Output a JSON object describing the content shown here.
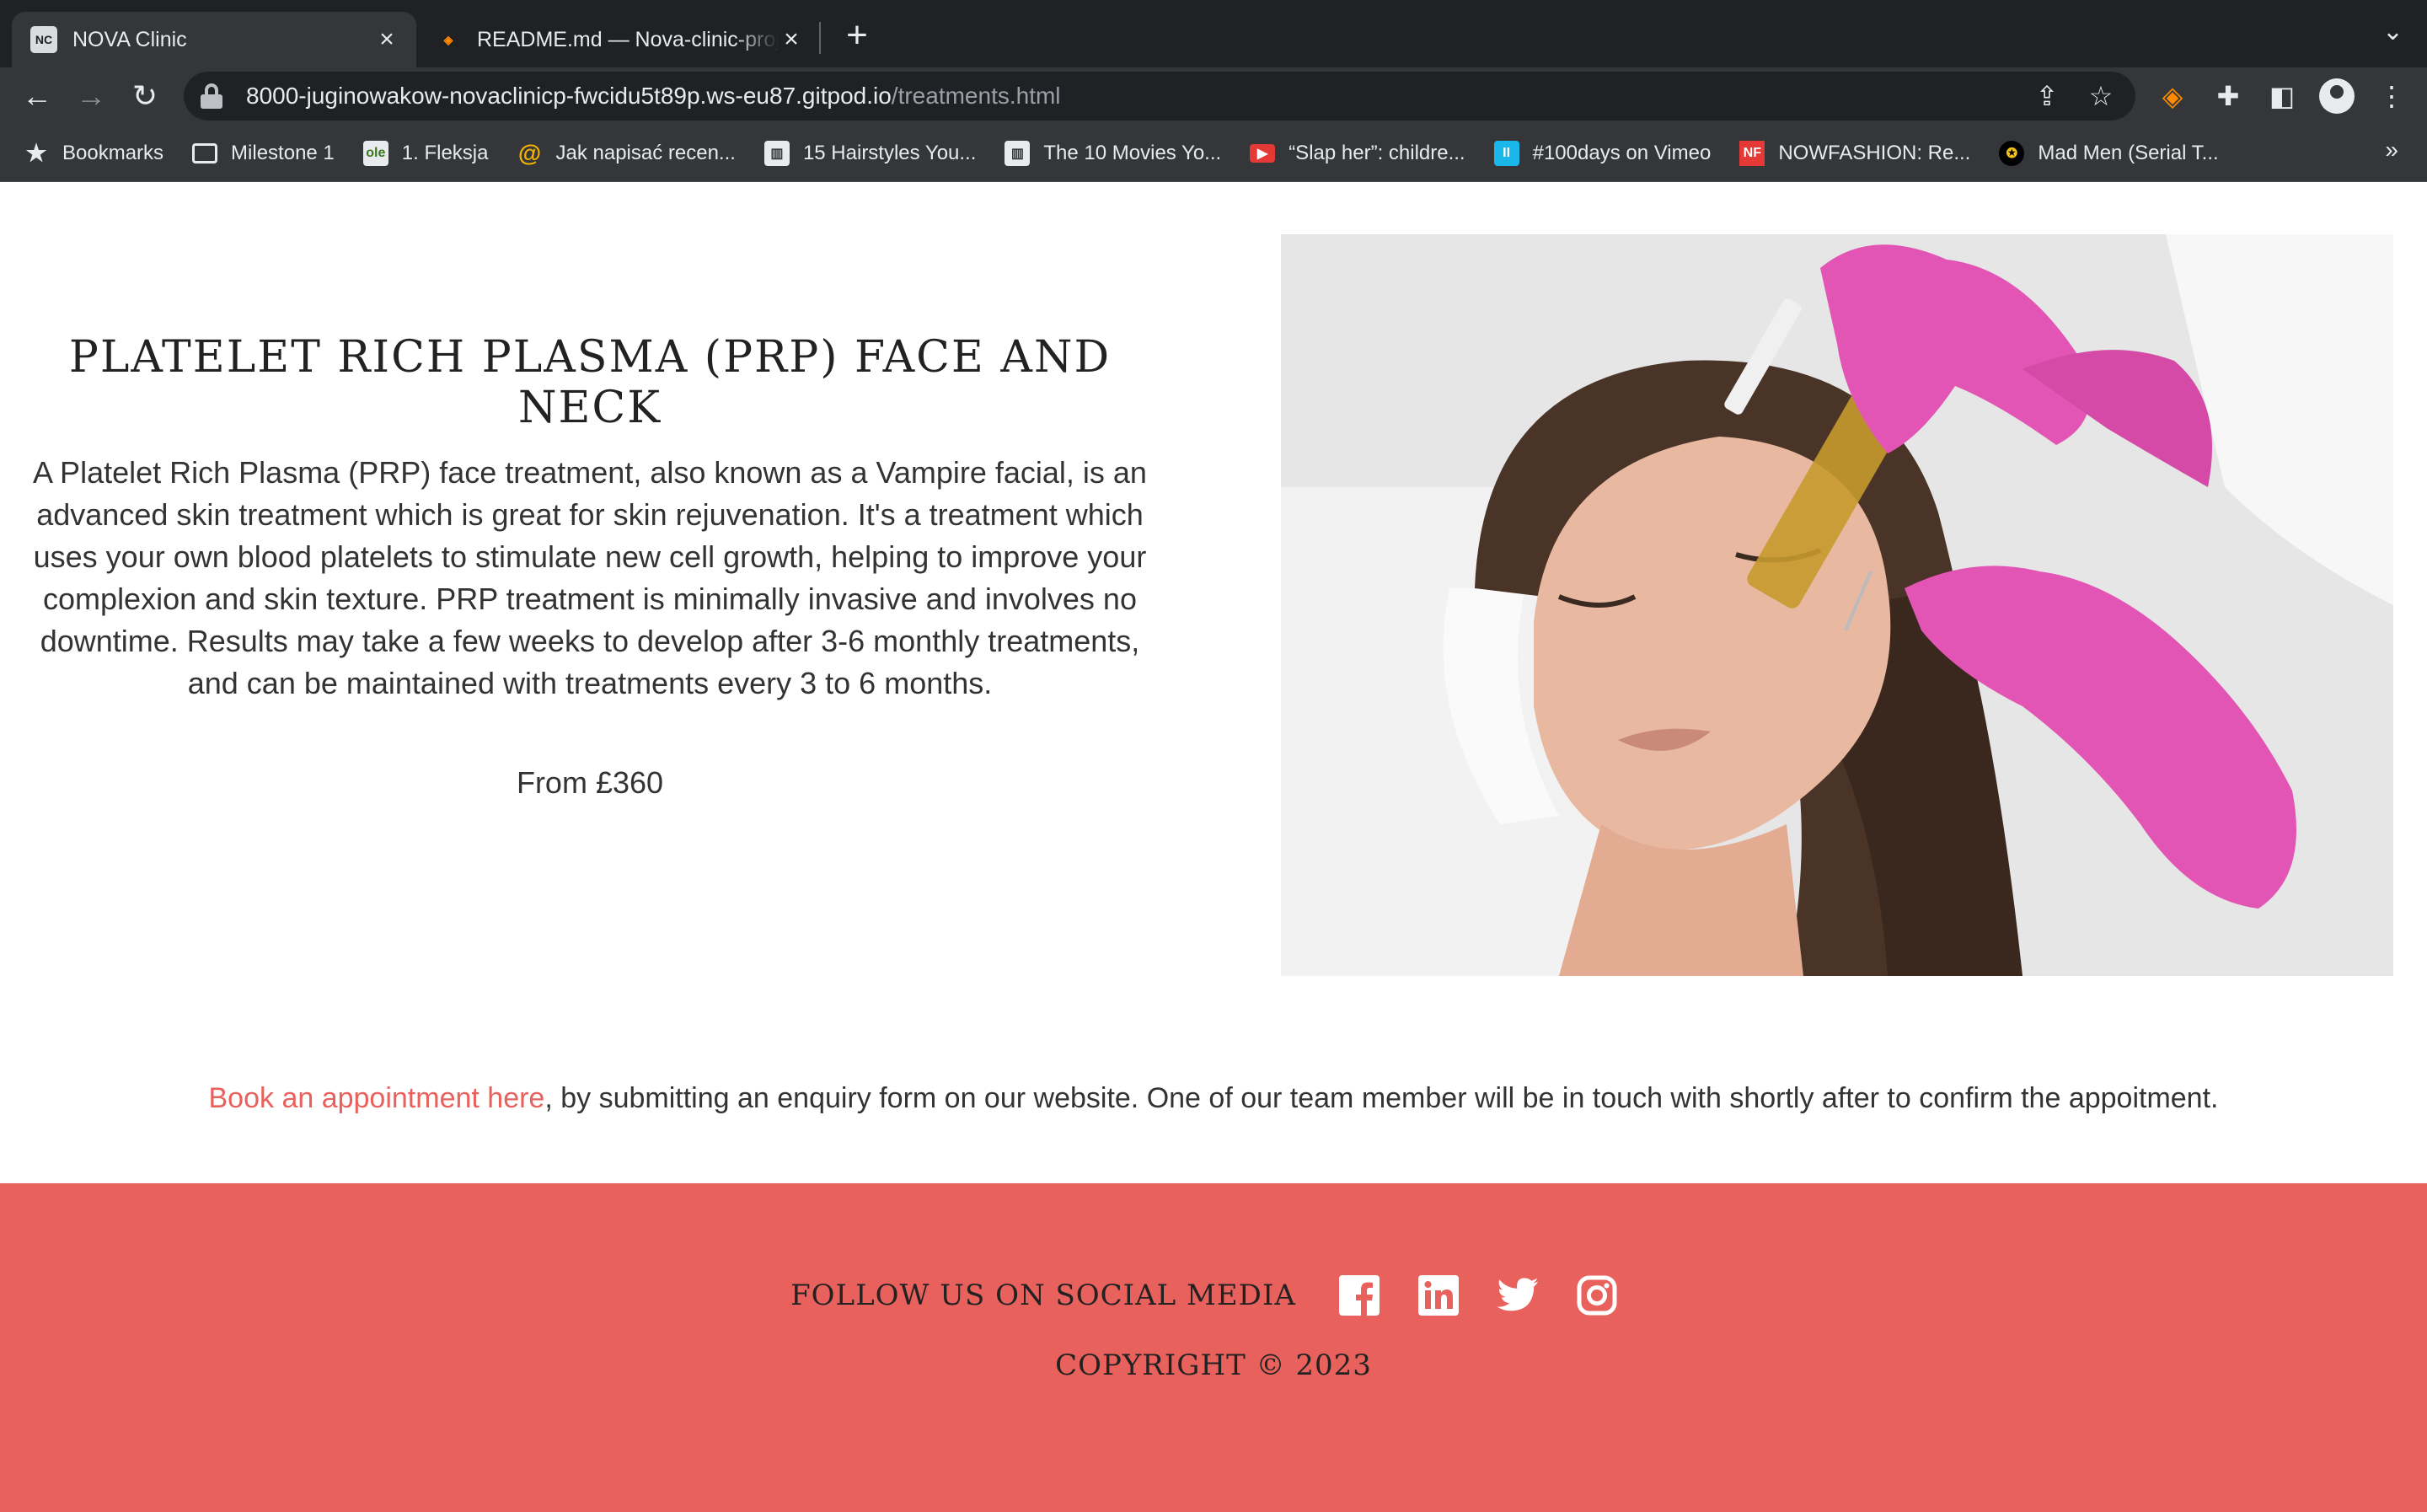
{
  "browser": {
    "tabs": [
      {
        "title": "NOVA Clinic",
        "icon": "nova-favicon",
        "active": true
      },
      {
        "title": "README.md — Nova-clinic-project",
        "icon": "gitpod-favicon",
        "active": false
      }
    ],
    "url": {
      "host": "8000-juginowakow-novaclinicp-fwcidu5t89p.ws-eu87.gitpod.io",
      "path": "/treatments.html"
    },
    "bookmarks": [
      {
        "label": "Bookmarks",
        "icon": "star-icon"
      },
      {
        "label": "Milestone 1",
        "icon": "folder-icon"
      },
      {
        "label": "1. Fleksja",
        "icon": "ole-favicon"
      },
      {
        "label": "Jak napisać recen...",
        "icon": "spiral-favicon"
      },
      {
        "label": "15 Hairstyles You...",
        "icon": "page-favicon"
      },
      {
        "label": "The 10 Movies Yo...",
        "icon": "page-favicon"
      },
      {
        "label": "“Slap her”: childre...",
        "icon": "youtube-favicon"
      },
      {
        "label": "#100days on Vimeo",
        "icon": "vimeo-favicon"
      },
      {
        "label": "NOWFASHION: Re...",
        "icon": "nf-favicon"
      },
      {
        "label": "Mad Men (Serial T...",
        "icon": "film-favicon"
      }
    ],
    "bookmarks_more": "»",
    "colors": {
      "tabstrip": "#202124",
      "toolbar": "#35363a"
    }
  },
  "treatment": {
    "title": "PLATELET RICH PLASMA (PRP) FACE AND NECK",
    "description": "A Platelet Rich Plasma (PRP) face treatment, also known as a Vampire facial, is an advanced skin treatment which is great for skin rejuvenation. It's a treatment which uses your own blood platelets to stimulate new cell growth, helping to improve your complexion and skin texture. PRP treatment is minimally invasive and involves no downtime. Results may take a few weeks to develop after 3-6 monthly treatments, and can be maintained with treatments every 3 to 6 months.",
    "price": "From £360",
    "image_alt": "Woman receiving PRP injection treatment on face from gloved hands"
  },
  "booking": {
    "link_text": "Book an appointment here",
    "rest_text": ", by submitting an enquiry form on our website. One of our team member will be in touch with shortly after to confirm the appoitment."
  },
  "footer": {
    "follow_label": "FOLLOW US ON SOCIAL MEDIA",
    "social": [
      "facebook-icon",
      "linkedin-icon",
      "twitter-icon",
      "instagram-icon"
    ],
    "copyright": "COPYRIGHT © 2023"
  },
  "colors": {
    "accent": "#e8615c",
    "text": "#333333"
  }
}
